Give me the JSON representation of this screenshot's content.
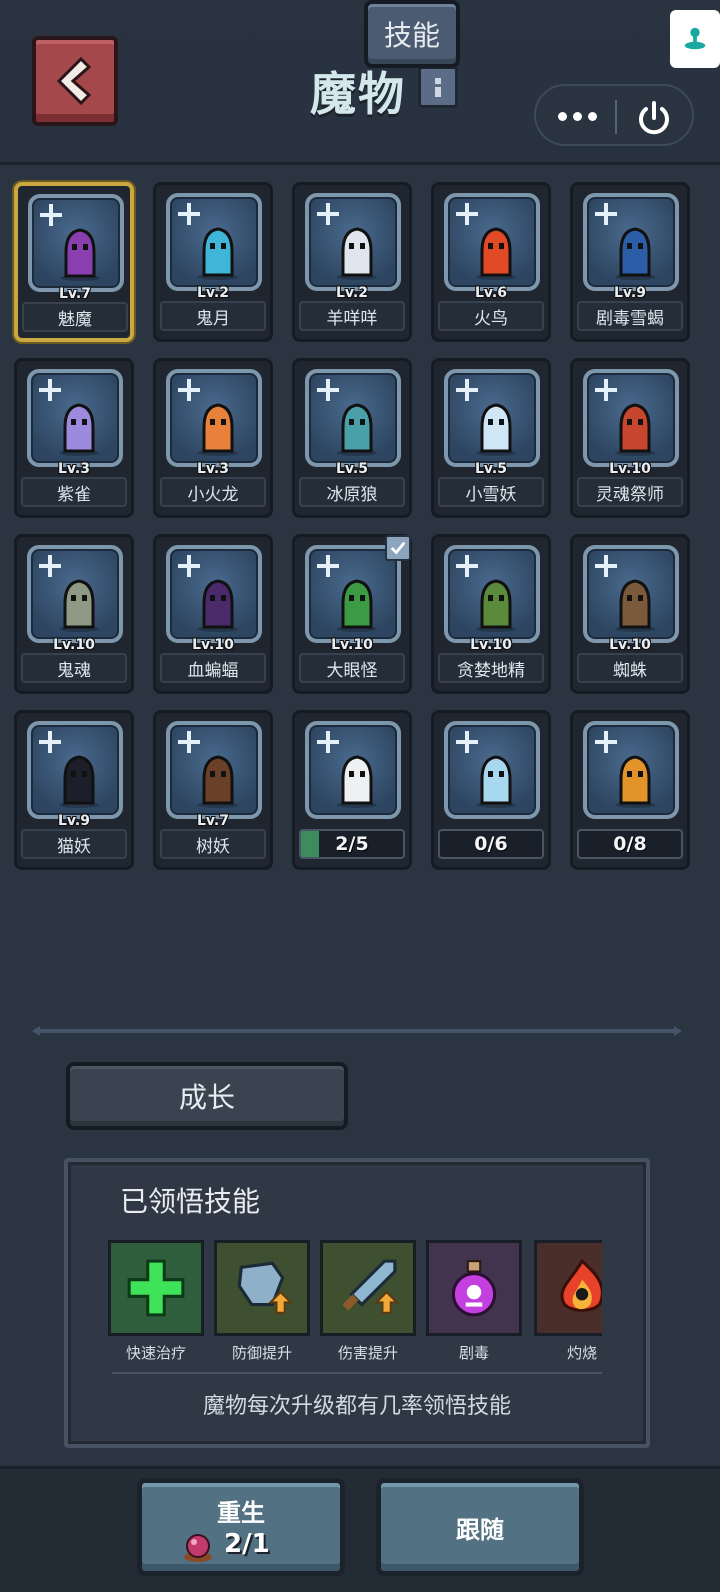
{
  "header": {
    "title": "魔物",
    "back_icon": "back-arrow-icon",
    "info_icon": "info-icon",
    "more_icon": "more-dots-icon",
    "power_icon": "power-icon"
  },
  "monsters": [
    {
      "name": "魅魔",
      "level": "Lv.7",
      "selected": true,
      "color": "#8a3fb0"
    },
    {
      "name": "鬼月",
      "level": "Lv.2",
      "color": "#3fb6d8"
    },
    {
      "name": "羊咩咩",
      "level": "Lv.2",
      "color": "#dfe6ee"
    },
    {
      "name": "火鸟",
      "level": "Lv.6",
      "color": "#e24a26"
    },
    {
      "name": "剧毒雪蝎",
      "level": "Lv.9",
      "color": "#2c5ea8"
    },
    {
      "name": "紫雀",
      "level": "Lv.3",
      "color": "#9c8adf"
    },
    {
      "name": "小火龙",
      "level": "Lv.3",
      "color": "#e8823a"
    },
    {
      "name": "冰原狼",
      "level": "Lv.5",
      "color": "#4aa0a8"
    },
    {
      "name": "小雪妖",
      "level": "Lv.5",
      "color": "#cfe6f6"
    },
    {
      "name": "灵魂祭师",
      "level": "Lv.10",
      "color": "#c6462e"
    },
    {
      "name": "鬼魂",
      "level": "Lv.10",
      "color": "#8e9a86"
    },
    {
      "name": "血蝙蝠",
      "level": "Lv.10",
      "color": "#4a2a6a"
    },
    {
      "name": "大眼怪",
      "level": "Lv.10",
      "checked": true,
      "color": "#3c9a44"
    },
    {
      "name": "贪婪地精",
      "level": "Lv.10",
      "color": "#5a8a3c"
    },
    {
      "name": "蜘蛛",
      "level": "Lv.10",
      "color": "#7a5a3a"
    },
    {
      "name": "猫妖",
      "level": "Lv.9",
      "color": "#1c1f2a"
    },
    {
      "name": "树妖",
      "level": "Lv.7",
      "color": "#6a4028"
    },
    {
      "progress": "2/5",
      "progress_value": 0.4,
      "color": "#eef0f2"
    },
    {
      "progress": "0/6",
      "progress_value": 0,
      "color": "#a8d8f0"
    },
    {
      "progress": "0/8",
      "progress_value": 0,
      "color": "#e2942a"
    }
  ],
  "tabs": [
    {
      "label": "成长",
      "active": false
    },
    {
      "label": "技能",
      "active": true
    }
  ],
  "skills_panel": {
    "title": "已领悟技能",
    "skills": [
      {
        "label": "快速治疗",
        "icon": "green-cross-icon"
      },
      {
        "label": "防御提升",
        "icon": "shield-up-icon"
      },
      {
        "label": "伤害提升",
        "icon": "sword-up-icon"
      },
      {
        "label": "剧毒",
        "icon": "poison-potion-icon"
      },
      {
        "label": "灼烧",
        "icon": "fire-icon"
      }
    ],
    "tip": "魔物每次升级都有几率领悟技能"
  },
  "bottom": {
    "rebirth_label": "重生",
    "rebirth_count": "2/1",
    "follow_label": "跟随"
  }
}
